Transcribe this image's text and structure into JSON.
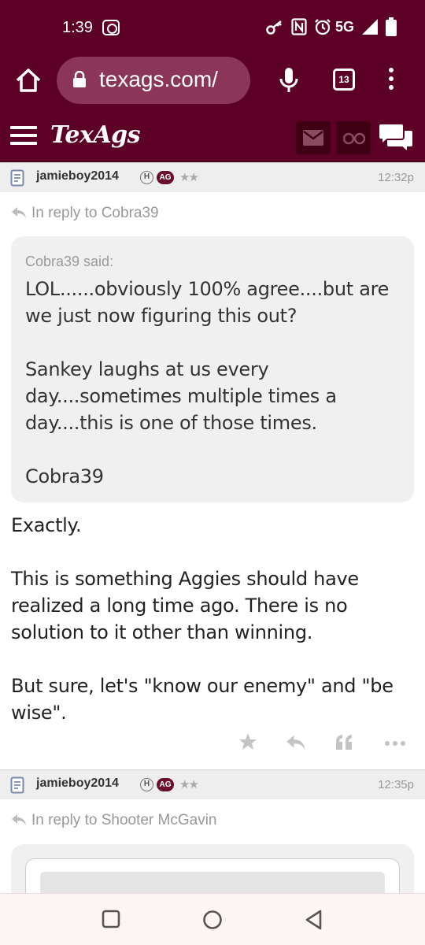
{
  "status_bar": {
    "time": "1:39",
    "network": "5G"
  },
  "browser": {
    "url": "texags.com/",
    "tab_count": "13"
  },
  "site": {
    "logo": "TexAgs"
  },
  "posts": [
    {
      "user": "jamieboy2014",
      "badge_h": "H",
      "badge_ag": "AG",
      "stars": "★★",
      "time": "12:32p",
      "reply_to": "In reply to Cobra39",
      "quote_said": "Cobra39 said:",
      "quote_text": "LOL......obviously 100% agree....but are we just now figuring this out?\n\nSankey laughs at us every day....sometimes multiple times a day....this is one of those times.\n\nCobra39",
      "body": "Exactly.\n\nThis is something Aggies should have realized a long time ago. There is no solution to it other than winning.\n\nBut sure, let's \"know our enemy\" and \"be wise\"."
    },
    {
      "user": "jamieboy2014",
      "badge_h": "H",
      "badge_ag": "AG",
      "stars": "★★",
      "time": "12:35p",
      "reply_to": "In reply to Shooter McGavin"
    }
  ],
  "colors": {
    "maroon": "#5c0025",
    "url_bg": "#8b3558",
    "quote_bg": "#f0f0f0",
    "muted_text": "#999999"
  }
}
